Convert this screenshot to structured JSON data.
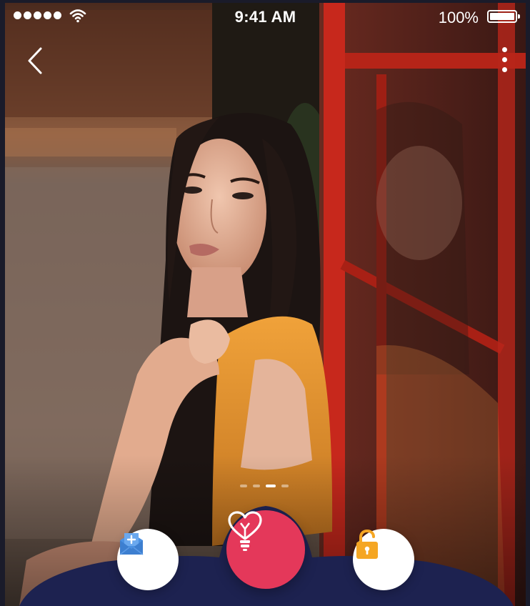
{
  "status_bar": {
    "time": "9:41 AM",
    "battery_percent": "100%",
    "signal_bars": 5,
    "wifi_icon": "wifi-icon",
    "battery_icon": "battery-icon"
  },
  "nav": {
    "back_icon": "chevron-left-icon",
    "more_icon": "more-vertical-icon"
  },
  "carousel": {
    "page_count": 4,
    "active_index": 2
  },
  "actions": [
    {
      "name": "add-mail-button",
      "icon": "mail-add-icon",
      "color": "#4a90e2"
    },
    {
      "name": "love-idea-button",
      "icon": "heart-bulb-icon",
      "color": "#e4385a"
    },
    {
      "name": "unlock-button",
      "icon": "unlock-icon",
      "color": "#f5a623"
    }
  ],
  "colors": {
    "dock": "#1d2250",
    "primary": "#e4385a"
  }
}
